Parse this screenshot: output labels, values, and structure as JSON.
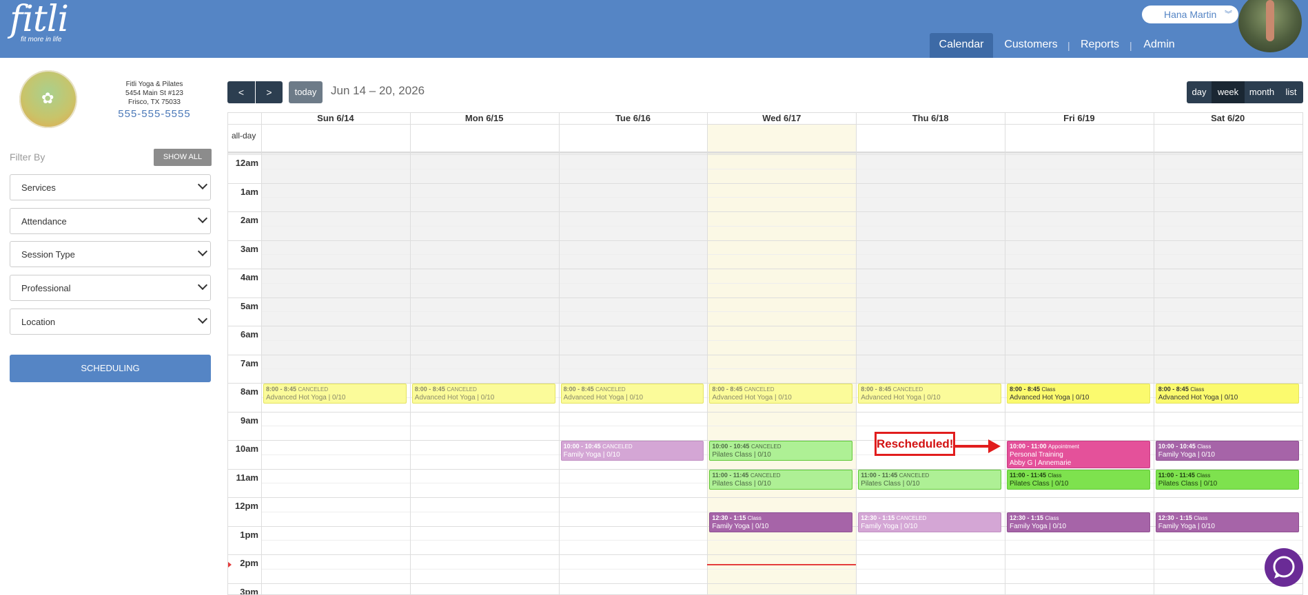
{
  "app": {
    "brand": "fitli",
    "tagline": "fit more in life"
  },
  "user": {
    "name": "Hana Martin"
  },
  "nav": {
    "items": [
      "Calendar",
      "Customers",
      "Reports",
      "Admin"
    ],
    "active": "Calendar"
  },
  "studio": {
    "name": "Fitli Yoga & Pilates",
    "address1": "5454 Main St #123",
    "address2": "Frisco, TX 75033",
    "phone": "555-555-5555"
  },
  "filters": {
    "label": "Filter By",
    "show_all": "SHOW ALL",
    "selects": [
      "Services",
      "Attendance",
      "Session Type",
      "Professional",
      "Location"
    ]
  },
  "scheduling_button": "SCHEDULING",
  "toolbar": {
    "prev": "<",
    "next": ">",
    "today": "today",
    "date_range": "Jun 14 – 20, 2026",
    "views": [
      "day",
      "week",
      "month",
      "list"
    ],
    "active_view": "week"
  },
  "calendar": {
    "days": [
      "Sun 6/14",
      "Mon 6/15",
      "Tue 6/16",
      "Wed 6/17",
      "Thu 6/18",
      "Fri 6/19",
      "Sat 6/20"
    ],
    "today_index": 3,
    "allday_label": "all-day",
    "hours": [
      "12am",
      "1am",
      "2am",
      "3am",
      "4am",
      "5am",
      "6am",
      "7am",
      "8am",
      "9am",
      "10am",
      "11am",
      "12pm",
      "1pm",
      "2pm",
      "3pm"
    ],
    "events": [
      {
        "day": 0,
        "start": 8,
        "end": 8.75,
        "time": "8:00 - 8:45",
        "tag": "CANCELED",
        "title": "Advanced Hot Yoga | 0/10",
        "color": "yellow",
        "canceled": true
      },
      {
        "day": 1,
        "start": 8,
        "end": 8.75,
        "time": "8:00 - 8:45",
        "tag": "CANCELED",
        "title": "Advanced Hot Yoga | 0/10",
        "color": "yellow",
        "canceled": true
      },
      {
        "day": 2,
        "start": 8,
        "end": 8.75,
        "time": "8:00 - 8:45",
        "tag": "CANCELED",
        "title": "Advanced Hot Yoga | 0/10",
        "color": "yellow",
        "canceled": true
      },
      {
        "day": 3,
        "start": 8,
        "end": 8.75,
        "time": "8:00 - 8:45",
        "tag": "CANCELED",
        "title": "Advanced Hot Yoga | 0/10",
        "color": "yellow",
        "canceled": true
      },
      {
        "day": 4,
        "start": 8,
        "end": 8.75,
        "time": "8:00 - 8:45",
        "tag": "CANCELED",
        "title": "Advanced Hot Yoga | 0/10",
        "color": "yellow",
        "canceled": true
      },
      {
        "day": 5,
        "start": 8,
        "end": 8.75,
        "time": "8:00 - 8:45",
        "tag": "Class",
        "title": "Advanced Hot Yoga | 0/10",
        "color": "yellow",
        "canceled": false
      },
      {
        "day": 6,
        "start": 8,
        "end": 8.75,
        "time": "8:00 - 8:45",
        "tag": "Class",
        "title": "Advanced Hot Yoga | 0/10",
        "color": "yellow",
        "canceled": false
      },
      {
        "day": 2,
        "start": 10,
        "end": 10.75,
        "time": "10:00 - 10:45",
        "tag": "CANCELED",
        "title": "Family Yoga | 0/10",
        "color": "purple",
        "canceled": true
      },
      {
        "day": 3,
        "start": 10,
        "end": 10.75,
        "time": "10:00 - 10:45",
        "tag": "CANCELED",
        "title": "Pilates Class | 0/10",
        "color": "green",
        "canceled": true
      },
      {
        "day": 5,
        "start": 10,
        "end": 11,
        "time": "10:00 - 11:00",
        "tag": "Appointment",
        "title": "Personal Training",
        "subtitle": "Abby G | Annemarie",
        "color": "pink",
        "canceled": false
      },
      {
        "day": 6,
        "start": 10,
        "end": 10.75,
        "time": "10:00 - 10:45",
        "tag": "Class",
        "title": "Family Yoga | 0/10",
        "color": "purple",
        "canceled": false
      },
      {
        "day": 3,
        "start": 11,
        "end": 11.75,
        "time": "11:00 - 11:45",
        "tag": "CANCELED",
        "title": "Pilates Class | 0/10",
        "color": "green",
        "canceled": true
      },
      {
        "day": 4,
        "start": 11,
        "end": 11.75,
        "time": "11:00 - 11:45",
        "tag": "CANCELED",
        "title": "Pilates Class | 0/10",
        "color": "green",
        "canceled": true
      },
      {
        "day": 5,
        "start": 11,
        "end": 11.75,
        "time": "11:00 - 11:45",
        "tag": "Class",
        "title": "Pilates Class | 0/10",
        "color": "green",
        "canceled": false
      },
      {
        "day": 6,
        "start": 11,
        "end": 11.75,
        "time": "11:00 - 11:45",
        "tag": "Class",
        "title": "Pilates Class | 0/10",
        "color": "green",
        "canceled": false
      },
      {
        "day": 3,
        "start": 12.5,
        "end": 13.25,
        "time": "12:30 - 1:15",
        "tag": "Class",
        "title": "Family Yoga | 0/10",
        "color": "purple",
        "canceled": false
      },
      {
        "day": 4,
        "start": 12.5,
        "end": 13.25,
        "time": "12:30 - 1:15",
        "tag": "CANCELED",
        "title": "Family Yoga | 0/10",
        "color": "purple",
        "canceled": true
      },
      {
        "day": 5,
        "start": 12.5,
        "end": 13.25,
        "time": "12:30 - 1:15",
        "tag": "Class",
        "title": "Family Yoga | 0/10",
        "color": "purple",
        "canceled": false
      },
      {
        "day": 6,
        "start": 12.5,
        "end": 13.25,
        "time": "12:30 - 1:15",
        "tag": "Class",
        "title": "Family Yoga | 0/10",
        "color": "purple",
        "canceled": false
      }
    ],
    "now_hour": 14.33
  },
  "callout": {
    "text": "Rescheduled!"
  },
  "colors": {
    "brand": "#5585c5",
    "toolbar": "#2c3e50",
    "now": "#e43c3c",
    "chat": "#6a2b96"
  },
  "icons": {
    "chat": "chat-bubble-icon",
    "user_menu": "chevron-down-icon"
  }
}
